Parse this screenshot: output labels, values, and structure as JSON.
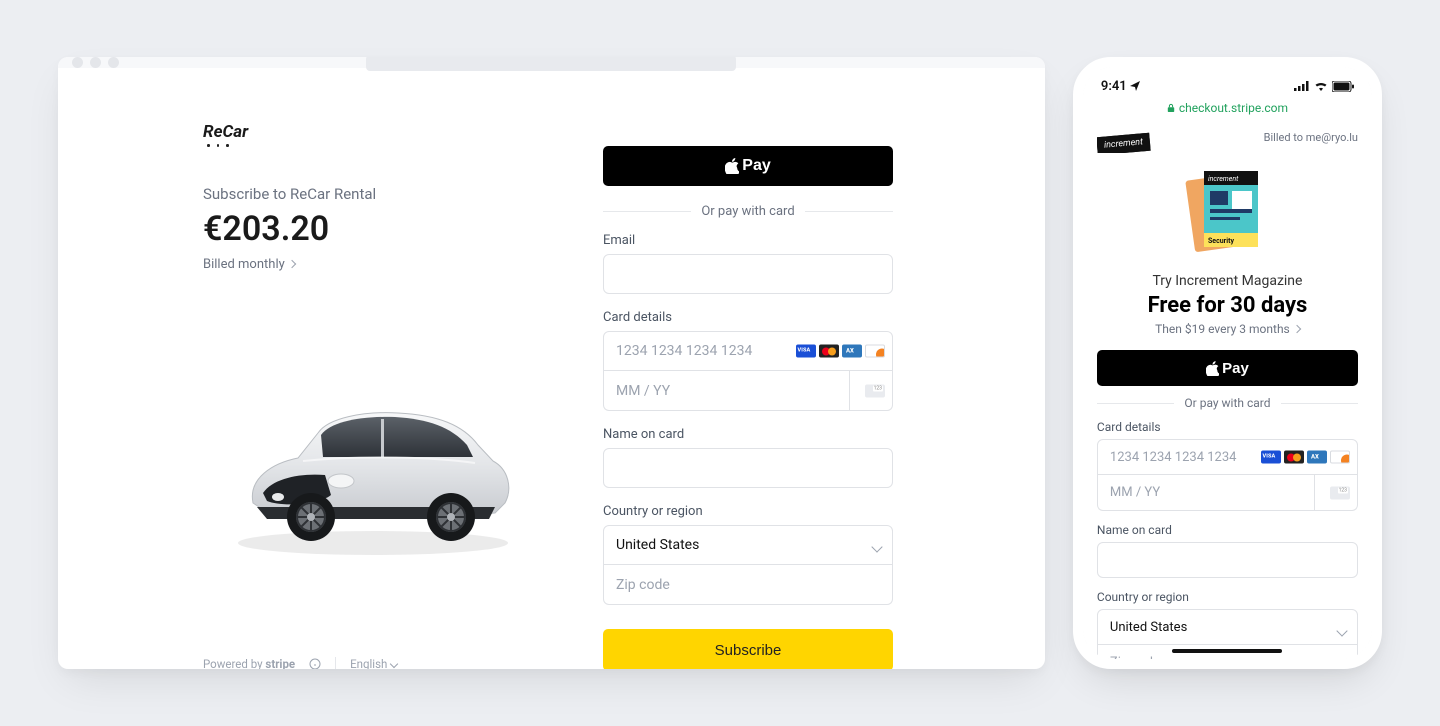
{
  "desktop": {
    "brand": "ReCar",
    "subscribe_title": "Subscribe to ReCar Rental",
    "price": "€203.20",
    "billing": "Billed monthly",
    "apple_pay": "Pay",
    "or_pay": "Or pay with card",
    "email_label": "Email",
    "card_label": "Card details",
    "card_placeholder": "1234 1234 1234 1234",
    "exp_placeholder": "MM / YY",
    "cvc_placeholder": "CVC",
    "name_label": "Name on card",
    "country_label": "Country or region",
    "country_value": "United States",
    "zip_placeholder": "Zip code",
    "subscribe_btn": "Subscribe",
    "powered_by": "Powered by",
    "stripe": "stripe",
    "language": "English"
  },
  "phone": {
    "time": "9:41",
    "url": "checkout.stripe.com",
    "brand": "increment",
    "billed_to": "Billed to me@ryo.lu",
    "try_line": "Try Increment Magazine",
    "free_line": "Free for 30 days",
    "then_line": "Then $19 every 3 months",
    "apple_pay": "Pay",
    "or_pay": "Or pay with card",
    "card_label": "Card details",
    "card_placeholder": "1234 1234 1234 1234",
    "exp_placeholder": "MM / YY",
    "cvc_placeholder": "CVC",
    "name_label": "Name on card",
    "country_label": "Country or region",
    "country_value": "United States",
    "zip_placeholder": "Zip code"
  }
}
